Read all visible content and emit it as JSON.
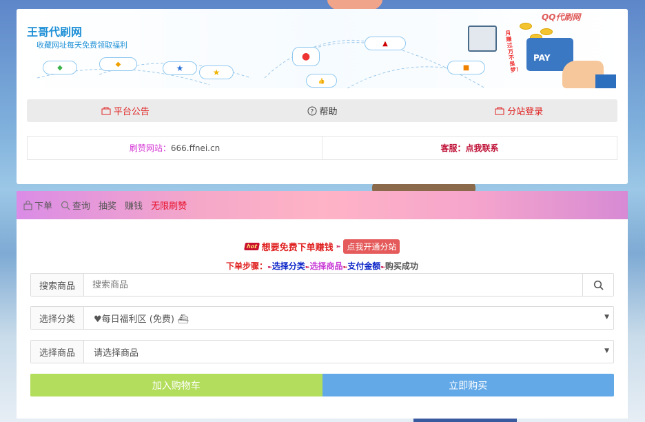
{
  "header": {
    "title": "王哥代刷网",
    "subtitle": "收藏网址每天免费领取福利",
    "banner_logo": "QQ代刷网",
    "banner_pay_text": "PAY",
    "banner_side_text": "月赚过万不是梦！"
  },
  "nav": {
    "notice_label": "平台公告",
    "help_label": "帮助",
    "login_label": "分站登录"
  },
  "info": {
    "site_label": "刷赞网站：",
    "site_value": "666.ffnei.cn",
    "service_label": "客服：点我联系"
  },
  "tabs": [
    {
      "label": "下单",
      "icon": "bag-icon"
    },
    {
      "label": "查询",
      "icon": "search-icon"
    },
    {
      "label": "抽奖"
    },
    {
      "label": "赚钱"
    },
    {
      "label": "无限刷赞"
    }
  ],
  "promo": {
    "badge": "hot",
    "text": "想要免费下单赚钱",
    "button": "点我开通分站"
  },
  "steps": {
    "prefix": "下单步骤：",
    "s1": "选择分类",
    "s2": "选择商品",
    "s3": "支付金额",
    "s4": "购买成功"
  },
  "form": {
    "search_label": "搜索商品",
    "search_placeholder": "搜索商品",
    "category_label": "选择分类",
    "category_value": "♥每日福利区 (免费) ⛴",
    "product_label": "选择商品",
    "product_value": "请选择商品"
  },
  "buttons": {
    "cart": "加入购物车",
    "buy": "立即购买"
  },
  "colors": {
    "brand_blue": "#1e90d6",
    "nav_red": "#e02020",
    "cart_green": "#b3dd5c",
    "buy_blue": "#63a9e8"
  }
}
